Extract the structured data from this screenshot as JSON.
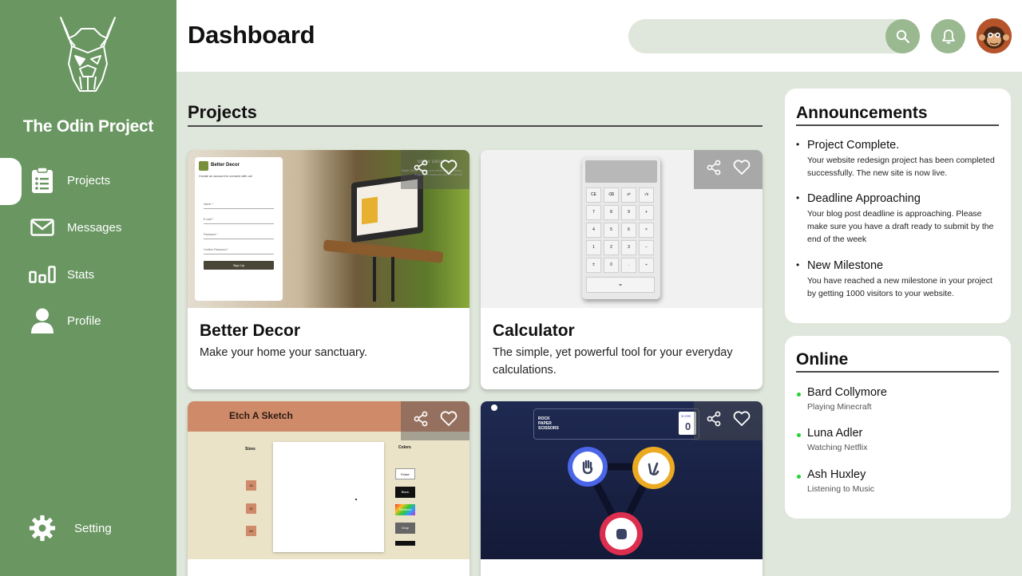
{
  "brand": {
    "name": "The Odin Project"
  },
  "sidebar": {
    "items": [
      {
        "label": "Projects",
        "icon": "clipboard-icon",
        "active": true
      },
      {
        "label": "Messages",
        "icon": "envelope-icon"
      },
      {
        "label": "Stats",
        "icon": "bar-stats-icon"
      },
      {
        "label": "Profile",
        "icon": "user-icon"
      }
    ],
    "settings_label": "Setting"
  },
  "header": {
    "title": "Dashboard",
    "search_placeholder": ""
  },
  "projects": {
    "title": "Projects",
    "cards": [
      {
        "title": "Better Decor",
        "desc": "Make your home your sanctuary.",
        "thumb": {
          "brand": "Better Decor",
          "subtitle": "Create an account to connect with us!",
          "fields": [
            "Name *",
            "E-mail *",
            "Password *",
            "Confirm Password *"
          ],
          "button": "Sign Up",
          "overlay_title": "Better Decor",
          "overlay_text": "Better Decor — Make your home your sanctuary. Explore the ideas you want to improve"
        }
      },
      {
        "title": "Calculator",
        "desc": "The simple, yet powerful tool for your everyday calculations.",
        "thumb": {
          "keys": [
            "CE",
            "⌫",
            "x²",
            "√x",
            "7",
            "8",
            "9",
            "+",
            "4",
            "5",
            "6",
            "×",
            "1",
            "2",
            "3",
            "−",
            "±",
            "0",
            ".",
            "÷"
          ],
          "equals": "="
        }
      },
      {
        "title": "",
        "desc": "",
        "thumb": {
          "title": "Etch A Sketch",
          "sizes_label": "Sizes",
          "sizes": [
            "16",
            "32",
            "64"
          ],
          "colors_label": "Colors",
          "colors": [
            "Erase",
            "Black",
            "Rainbow",
            "Gray"
          ]
        }
      },
      {
        "title": "",
        "desc": "",
        "thumb": {
          "game_title_lines": [
            "ROCK",
            "PAPER",
            "SCISSORS"
          ],
          "score_label": "SCORE",
          "score": "0"
        }
      }
    ]
  },
  "announcements": {
    "title": "Announcements",
    "items": [
      {
        "title": "Project Complete.",
        "text": "Your website redesign project has been completed successfully. The new site is now live."
      },
      {
        "title": "Deadline Approaching",
        "text": "Your blog post deadline is approaching. Please make sure you have a draft ready to submit by the end of the week"
      },
      {
        "title": "New Milestone",
        "text": "You have reached a new milestone in your project by getting 1000 visitors to your website."
      }
    ]
  },
  "online": {
    "title": "Online",
    "users": [
      {
        "name": "Bard Collymore",
        "status": "Playing Minecraft"
      },
      {
        "name": "Luna Adler",
        "status": "Watching Netflix"
      },
      {
        "name": "Ash Huxley",
        "status": "Listening to Music"
      }
    ]
  },
  "colors": {
    "sidebar": "#699661",
    "accent": "#9ab991",
    "background": "#dfe6db",
    "online_dot": "#27d13a"
  }
}
